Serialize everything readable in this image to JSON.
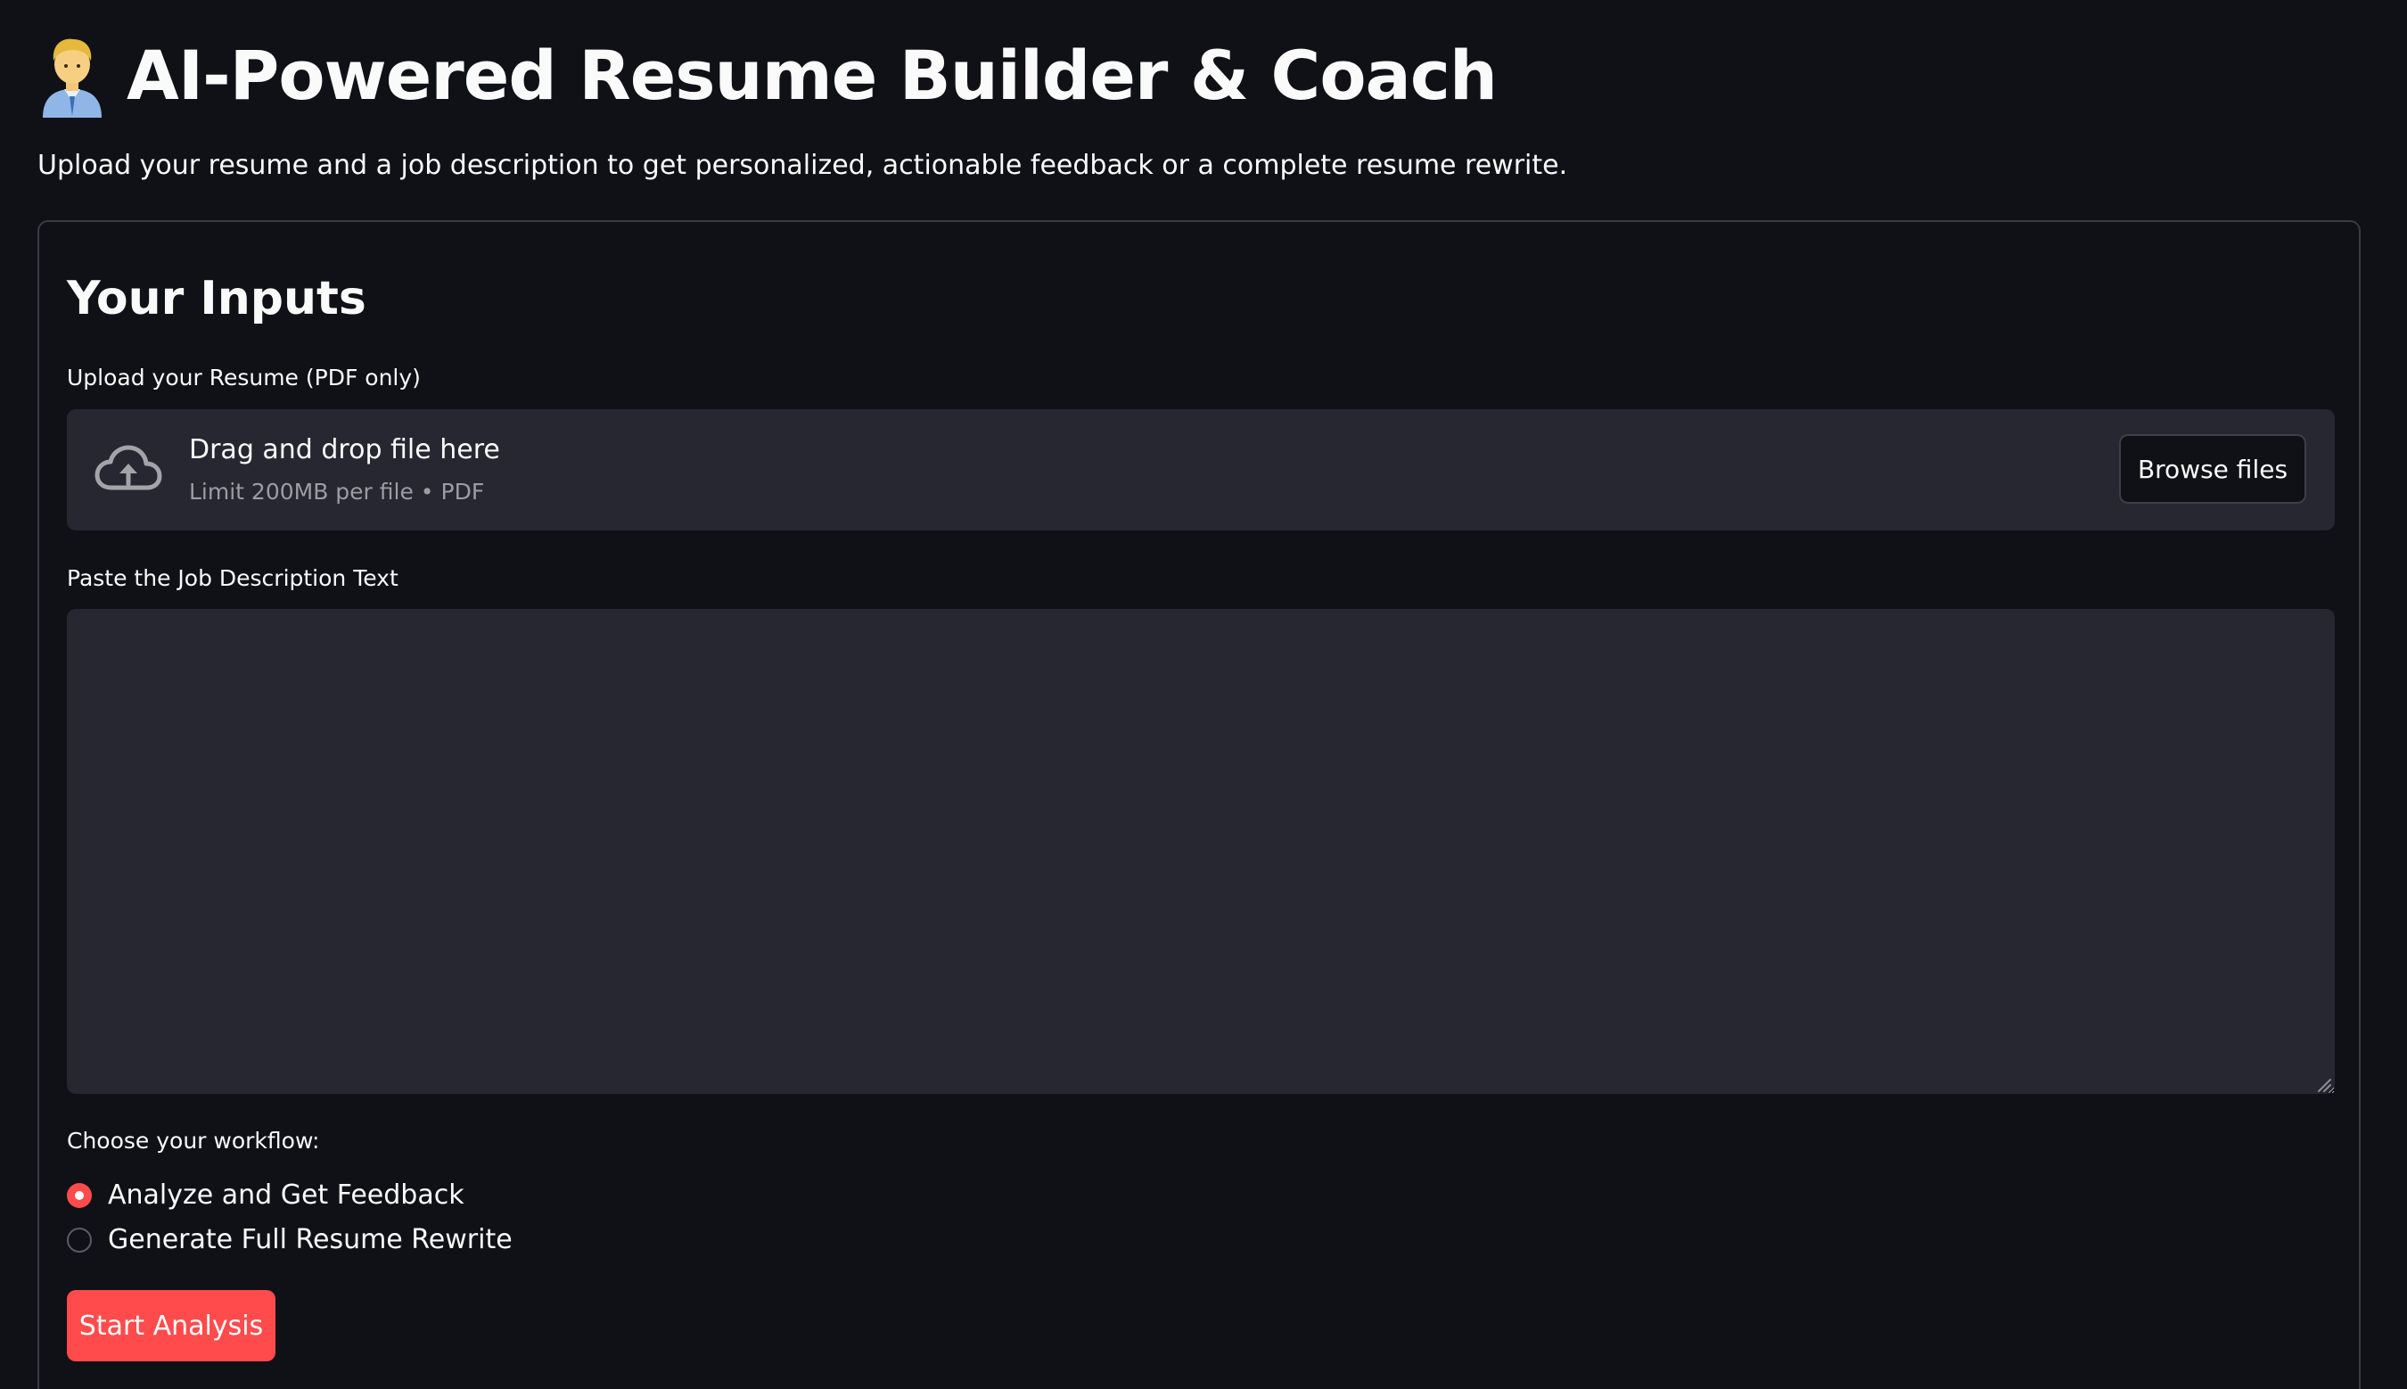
{
  "header": {
    "emoji_icon": "office-worker-icon",
    "title": "AI-Powered Resume Builder & Coach",
    "subtitle": "Upload your resume and a job description to get personalized, actionable feedback or a complete resume rewrite."
  },
  "inputs": {
    "section_title": "Your Inputs",
    "resume_upload": {
      "label": "Upload your Resume (PDF only)",
      "icon": "cloud-upload-icon",
      "drop_title": "Drag and drop file here",
      "drop_hint": "Limit 200MB per file • PDF",
      "browse_label": "Browse files"
    },
    "job_description": {
      "label": "Paste the Job Description Text",
      "value": "",
      "placeholder": ""
    },
    "workflow": {
      "label": "Choose your workflow:",
      "options": [
        {
          "label": "Analyze and Get Feedback",
          "selected": true
        },
        {
          "label": "Generate Full Resume Rewrite",
          "selected": false
        }
      ]
    },
    "submit_label": "Start Analysis"
  },
  "colors": {
    "background": "#0f1117",
    "surface": "#262730",
    "accent": "#ff4b4b",
    "text": "#fafafa",
    "muted_text": "#9c9da3"
  }
}
